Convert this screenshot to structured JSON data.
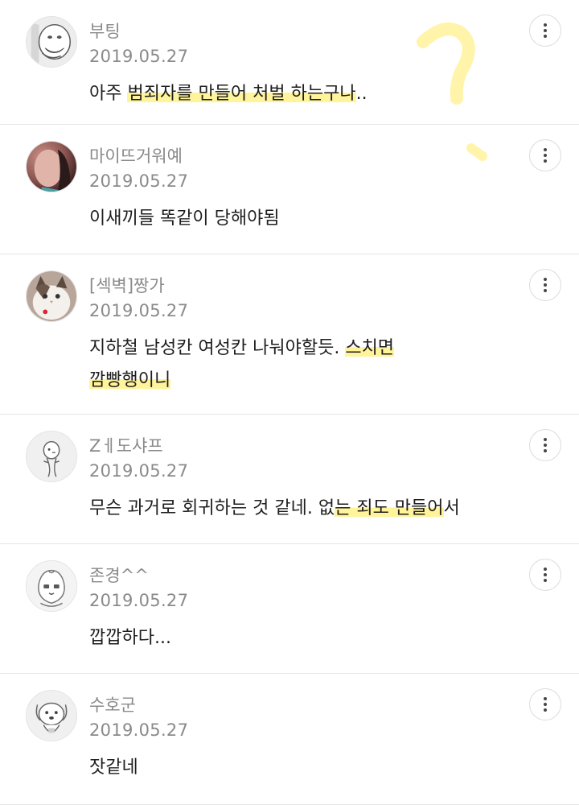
{
  "colors": {
    "highlighter": "#fff078",
    "text_primary": "#1e1e1e",
    "text_secondary": "#8a8a8a",
    "divider": "#e6e6e6"
  },
  "comments": [
    {
      "nickname": "부팅",
      "date": "2019.05.27",
      "text_parts": [
        "아주 ",
        "범죄자를 만들어 처벌 하는구나",
        ".."
      ],
      "avatar_icon": "pengsoo-face-icon"
    },
    {
      "nickname": "마이뜨거워예",
      "date": "2019.05.27",
      "text_parts": [
        "이새끼들 똑같이 당해야됨"
      ],
      "avatar_icon": "person-photo-icon"
    },
    {
      "nickname": "[섹벽]짱가",
      "date": "2019.05.27",
      "text_parts": [
        "지하철 남성칸 여성칸 나눠야할듯. ",
        "스치면",
        " ",
        "깜빵행이니"
      ],
      "avatar_icon": "cat-photo-icon"
    },
    {
      "nickname": "Zㅔ도샤프",
      "date": "2019.05.27",
      "text_parts": [
        "무슨 과거로 회귀하는 것 같네. 없",
        "는 죄도 만들어",
        "서"
      ],
      "avatar_icon": "doodle-character-icon"
    },
    {
      "nickname": "존경^^",
      "date": "2019.05.27",
      "text_parts": [
        "깝깝하다..."
      ],
      "avatar_icon": "apeach-character-icon"
    },
    {
      "nickname": "수호군",
      "date": "2019.05.27",
      "text_parts": [
        "잣같네"
      ],
      "avatar_icon": "dog-character-icon"
    }
  ]
}
